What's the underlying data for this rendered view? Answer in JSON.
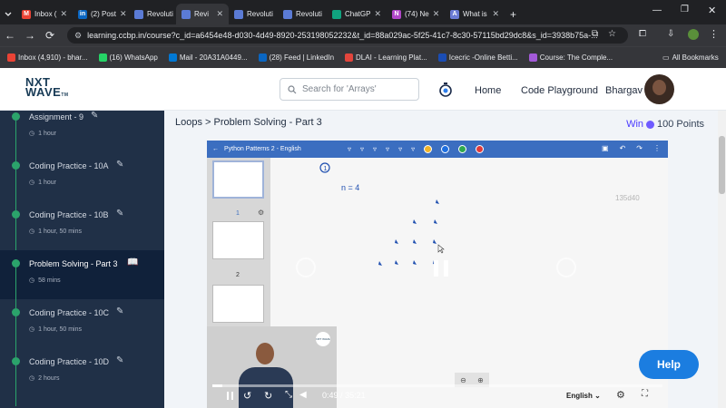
{
  "browser": {
    "tabs": [
      {
        "label": "Inbox (",
        "color": "#ea4335",
        "icon": "gmail-icon",
        "glyph": "M"
      },
      {
        "label": "(2) Post",
        "color": "#0a66c2",
        "icon": "linkedin-icon",
        "glyph": "in"
      },
      {
        "label": "Revoluti",
        "color": "#5b7bd5",
        "icon": "page-icon",
        "glyph": ""
      },
      {
        "label": "Revi",
        "color": "#5b7bd5",
        "icon": "page-icon",
        "glyph": "",
        "active": true
      },
      {
        "label": "Revoluti",
        "color": "#5b7bd5",
        "icon": "page-icon",
        "glyph": ""
      },
      {
        "label": "Revoluti",
        "color": "#5b7bd5",
        "icon": "page-icon",
        "glyph": ""
      },
      {
        "label": "ChatGP",
        "color": "#10a37f",
        "icon": "chatgpt-icon",
        "glyph": ""
      },
      {
        "label": "(74) Ne",
        "color": "#b147c9",
        "icon": "notification-icon",
        "glyph": "N"
      },
      {
        "label": "What is",
        "color": "#6b7bd5",
        "icon": "ai-icon",
        "glyph": "A"
      }
    ],
    "url": "learning.ccbp.in/course?c_id=a6454e48-d030-4d49-8920-253198052232&t_id=88a029ac-5f25-41c7-8c30-57115bd29dc8&s_id=3938b75a-...",
    "bookmarks": [
      {
        "label": "Inbox (4,910) - bhar...",
        "color": "#ea4335"
      },
      {
        "label": "(16) WhatsApp",
        "color": "#25d366"
      },
      {
        "label": "Mail - 20A31A0449...",
        "color": "#0078d4"
      },
      {
        "label": "(28) Feed | LinkedIn",
        "color": "#0a66c2"
      },
      {
        "label": "DLAI - Learning Plat...",
        "color": "#e2453c"
      },
      {
        "label": "Icecric -Online Betti...",
        "color": "#1a4db5"
      },
      {
        "label": "Course: The Comple...",
        "color": "#a35ad9"
      }
    ],
    "all_bookmarks": "All Bookmarks"
  },
  "header": {
    "logo_top": "NXT",
    "logo_bottom": "WAVE",
    "logo_tm": "TM",
    "search_placeholder": "Search for 'Arrays'",
    "nav": [
      "Home",
      "Code Playground"
    ],
    "user": "Bhargav"
  },
  "sidebar": {
    "items": [
      {
        "title": "Assignment - 9",
        "duration": "1 hour"
      },
      {
        "title": "Coding Practice - 10A",
        "duration": "1 hour"
      },
      {
        "title": "Coding Practice - 10B",
        "duration": "1 hour, 50 mins"
      },
      {
        "title": "Problem Solving - Part 3",
        "duration": "58 mins",
        "active": true
      },
      {
        "title": "Coding Practice - 10C",
        "duration": "1 hour, 50 mins"
      },
      {
        "title": "Coding Practice - 10D",
        "duration": "2 hours"
      }
    ]
  },
  "main": {
    "breadcrumb": "Loops > Problem Solving - Part 3",
    "win_label": "Win",
    "points": "100 Points"
  },
  "player": {
    "title": "Python Patterns 2 - English",
    "pages": [
      "1",
      "2"
    ],
    "note_number": "1",
    "note_text": "n = 4",
    "watermark": "135d40",
    "time_current": "0:49",
    "time_sep": "/",
    "time_total": "35:21",
    "language": "English",
    "progress": 0.023,
    "pen_colors": [
      "#f0b429",
      "#1e6fe0",
      "#2fa84f",
      "#e03a3a"
    ],
    "badge_text": "NXT WAVE"
  },
  "help_label": "Help"
}
